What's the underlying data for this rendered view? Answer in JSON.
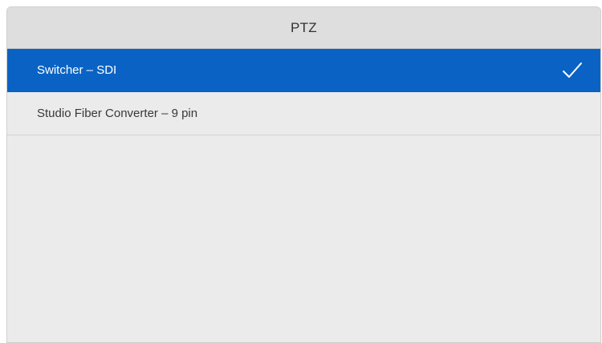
{
  "header": {
    "title": "PTZ"
  },
  "list": {
    "items": [
      {
        "label": "Switcher – SDI",
        "selected": true
      },
      {
        "label": "Studio Fiber Converter – 9 pin",
        "selected": false
      }
    ]
  },
  "colors": {
    "accent": "#0a63c4",
    "panel_bg": "#ebebeb",
    "header_bg": "#dedede"
  },
  "icons": {
    "selected_indicator": "check-icon"
  }
}
